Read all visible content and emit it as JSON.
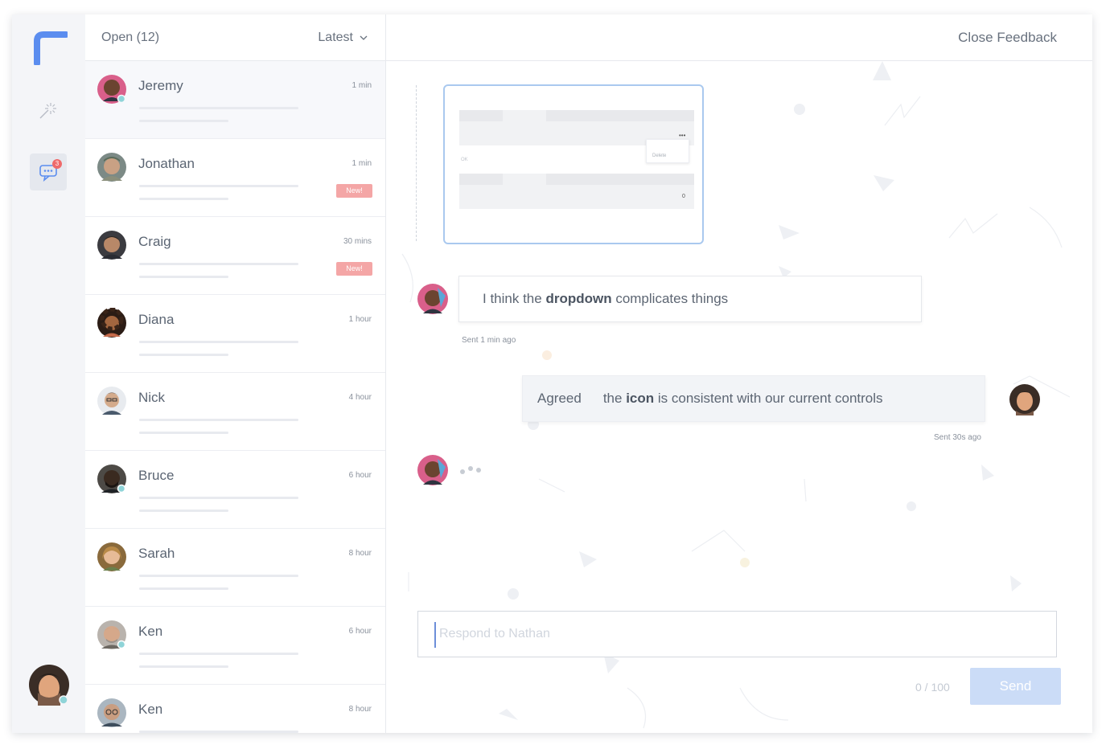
{
  "colors": {
    "accent": "#5b8def",
    "badge": "#ef6a6a",
    "new_badge": "#f4a6a6",
    "send_disabled": "#cbdcf7",
    "online": "#8fd4d8"
  },
  "rail": {
    "icons": [
      "logo-icon",
      "magic-wand-icon",
      "chat-bubble-icon"
    ],
    "chat_badge": "3"
  },
  "list": {
    "header": {
      "title": "Open (12)",
      "sort_label": "Latest"
    },
    "conversations": [
      {
        "name": "Jeremy",
        "time": "1 min",
        "new": "",
        "online": true
      },
      {
        "name": "Jonathan",
        "time": "1 min",
        "new": "New!",
        "online": false
      },
      {
        "name": "Craig",
        "time": "30 mins",
        "new": "New!",
        "online": false
      },
      {
        "name": "Diana",
        "time": "1 hour",
        "new": "",
        "online": false
      },
      {
        "name": "Nick",
        "time": "4 hour",
        "new": "",
        "online": false
      },
      {
        "name": "Bruce",
        "time": "6 hour",
        "new": "",
        "online": true
      },
      {
        "name": "Sarah",
        "time": "8 hour",
        "new": "",
        "online": false
      },
      {
        "name": "Ken",
        "time": "6 hour",
        "new": "",
        "online": true
      },
      {
        "name": "Ken",
        "time": "8 hour",
        "new": "",
        "online": false
      }
    ]
  },
  "main": {
    "close_label": "Close Feedback",
    "thumbnail": {
      "menu_label": "Delete",
      "row_label": "OK",
      "cell_value": "0"
    },
    "messages": [
      {
        "before": "I think the ",
        "bold": "dropdown",
        "after": " complicates things",
        "meta": "Sent 1 min ago"
      },
      {
        "prefix": "Agreed",
        "before": "the ",
        "bold": "icon",
        "after": " is consistent with our current controls",
        "meta": "Sent 30s ago"
      }
    ],
    "input": {
      "placeholder": "Respond to Nathan",
      "value": ""
    },
    "counter": "0 / 100",
    "send_label": "Send"
  }
}
